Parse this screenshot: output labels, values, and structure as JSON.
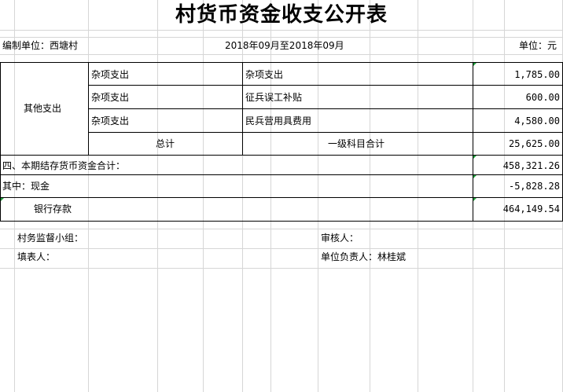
{
  "title": "村货币资金收支公开表",
  "header": {
    "unit_label": "编制单位：西塘村",
    "period": "2018年09月至2018年09月",
    "currency": "单位：元"
  },
  "group_label": "其他支出",
  "rows": [
    {
      "category": "杂项支出",
      "item": "杂项支出",
      "amount": "1,785.00"
    },
    {
      "category": "杂项支出",
      "item": "征兵误工补贴",
      "amount": "600.00"
    },
    {
      "category": "杂项支出",
      "item": "民兵营用具费用",
      "amount": "4,580.00"
    }
  ],
  "total": {
    "label": "总计",
    "sub_label": "一级科目合计",
    "amount": "25,625.00"
  },
  "summary": [
    {
      "label": "四、本期结存货币资金合计：",
      "amount": "458,321.26"
    },
    {
      "label": "其中：现金",
      "amount": "-5,828.28"
    },
    {
      "label": "银行存款",
      "amount": "464,149.54"
    }
  ],
  "footer": {
    "supervision": "村务监督小组：",
    "reviewer": "审核人：",
    "preparer": "填表人：",
    "responsible": "单位负责人：林桂斌"
  }
}
